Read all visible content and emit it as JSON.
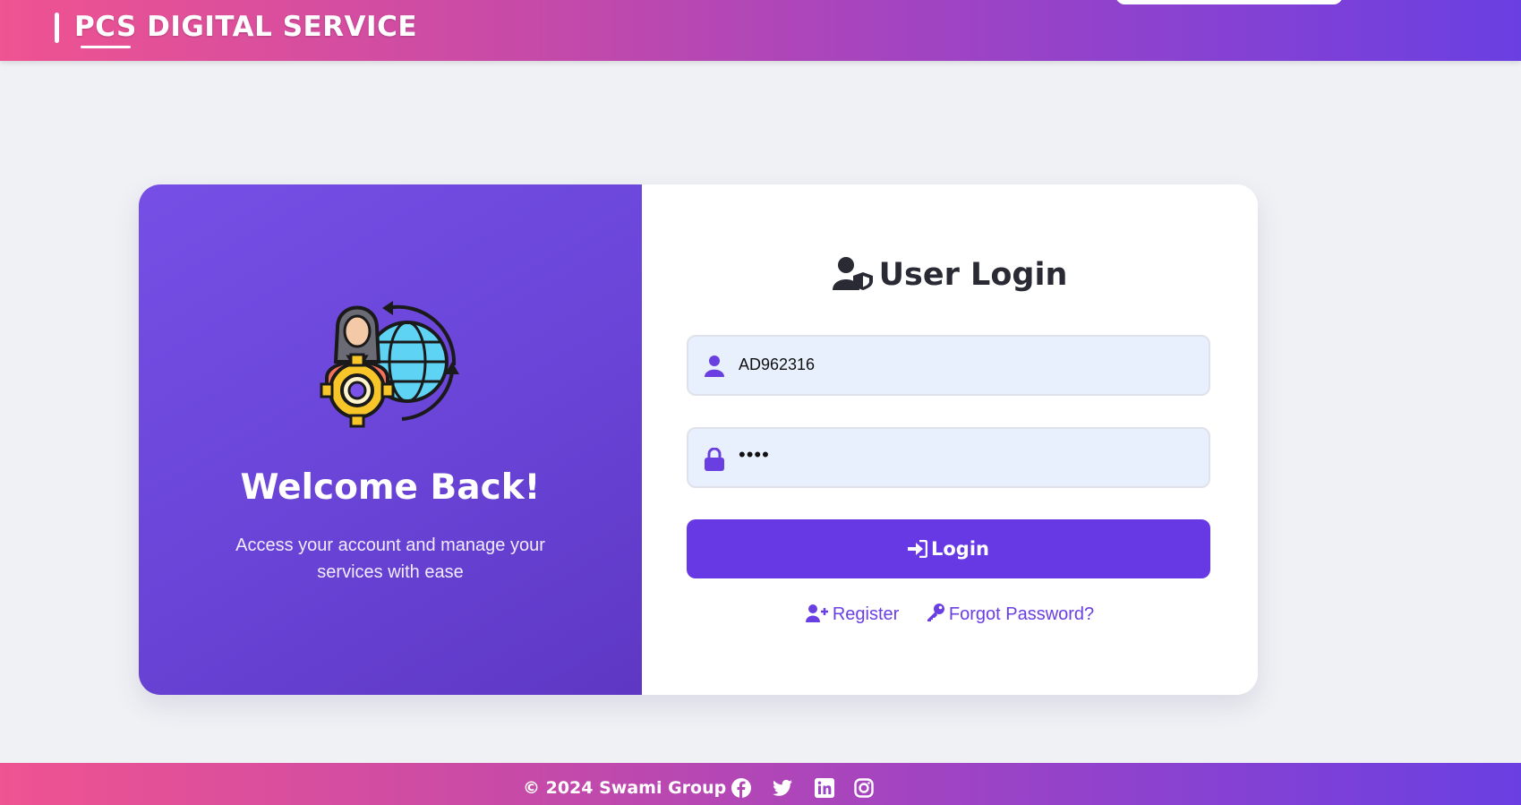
{
  "header": {
    "brand": "PCS DIGITAL SERVICE"
  },
  "hero": {
    "title": "Welcome Back!",
    "tagline": "Access your account and manage your services with ease"
  },
  "login": {
    "title": "User Login",
    "username_value": "AD962316",
    "password_value": "••••",
    "button_label": "Login",
    "register_label": "Register",
    "forgot_label": "Forgot Password?"
  },
  "footer": {
    "copyright": "© 2024 Swami Group",
    "social_icons": [
      "facebook-icon",
      "twitter-icon",
      "linkedin-icon",
      "instagram-icon"
    ]
  },
  "colors": {
    "accent": "#6639e4",
    "brand_gradient_start": "#ef5391",
    "brand_gradient_end": "#6a3fe2"
  }
}
